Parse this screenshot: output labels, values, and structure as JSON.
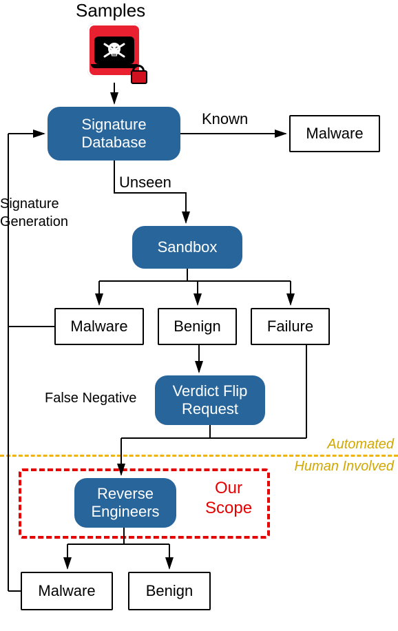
{
  "title": "Samples",
  "nodes": {
    "samples": "Samples",
    "signature_db": "Signature\nDatabase",
    "known_malware": "Malware",
    "sandbox": "Sandbox",
    "sandbox_malware": "Malware",
    "sandbox_benign": "Benign",
    "sandbox_failure": "Failure",
    "verdict_flip": "Verdict Flip\nRequest",
    "reverse_engineers": "Reverse\nEngineers",
    "re_malware": "Malware",
    "re_benign": "Benign"
  },
  "edges": {
    "known": "Known",
    "unseen": "Unseen",
    "sig_gen": "Signature\nGeneration",
    "false_neg": "False Negative"
  },
  "annotations": {
    "automated": "Automated",
    "human_involved": "Human Involved",
    "our_scope": "Our\nScope"
  },
  "chart_data": {
    "type": "flowchart",
    "nodes": [
      {
        "id": "samples",
        "label": "Samples",
        "type": "start"
      },
      {
        "id": "sigdb",
        "label": "Signature Database",
        "type": "process"
      },
      {
        "id": "known_malware",
        "label": "Malware",
        "type": "terminal"
      },
      {
        "id": "sandbox",
        "label": "Sandbox",
        "type": "process"
      },
      {
        "id": "sb_malware",
        "label": "Malware",
        "type": "terminal"
      },
      {
        "id": "sb_benign",
        "label": "Benign",
        "type": "terminal"
      },
      {
        "id": "sb_failure",
        "label": "Failure",
        "type": "terminal"
      },
      {
        "id": "verdict_flip",
        "label": "Verdict Flip Request",
        "type": "process"
      },
      {
        "id": "reverse_engineers",
        "label": "Reverse Engineers",
        "type": "process",
        "highlight": "our_scope"
      },
      {
        "id": "re_malware",
        "label": "Malware",
        "type": "terminal"
      },
      {
        "id": "re_benign",
        "label": "Benign",
        "type": "terminal"
      }
    ],
    "edges": [
      {
        "from": "samples",
        "to": "sigdb"
      },
      {
        "from": "sigdb",
        "to": "known_malware",
        "label": "Known"
      },
      {
        "from": "sigdb",
        "to": "sandbox",
        "label": "Unseen"
      },
      {
        "from": "sandbox",
        "to": "sb_malware"
      },
      {
        "from": "sandbox",
        "to": "sb_benign"
      },
      {
        "from": "sandbox",
        "to": "sb_failure"
      },
      {
        "from": "sb_benign",
        "to": "verdict_flip",
        "label": "False Negative"
      },
      {
        "from": "verdict_flip",
        "to": "reverse_engineers"
      },
      {
        "from": "sb_failure",
        "to": "reverse_engineers"
      },
      {
        "from": "reverse_engineers",
        "to": "re_malware"
      },
      {
        "from": "reverse_engineers",
        "to": "re_benign"
      },
      {
        "from": "sb_malware",
        "to": "sigdb",
        "label": "Signature Generation"
      },
      {
        "from": "re_malware",
        "to": "sigdb",
        "label": "Signature Generation"
      }
    ],
    "partition": {
      "line": "between verdict_flip and reverse_engineers",
      "above": "Automated",
      "below": "Human Involved"
    }
  }
}
